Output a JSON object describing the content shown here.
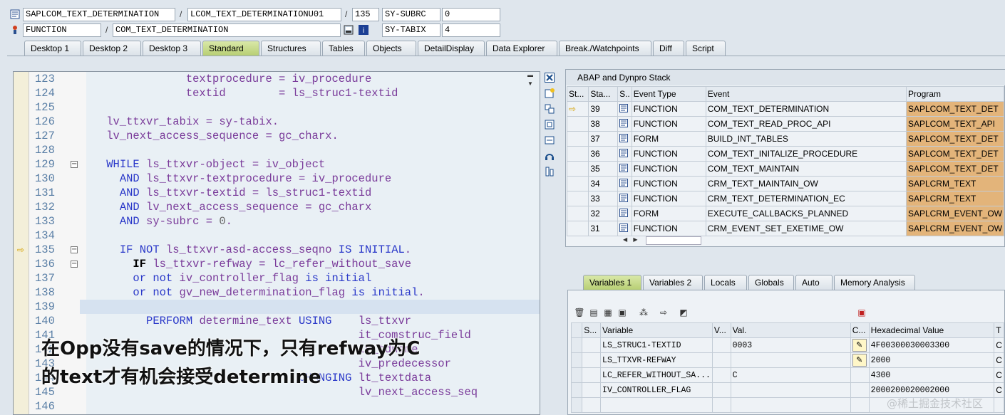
{
  "header": {
    "row1": {
      "program": "SAPLCOM_TEXT_DETERMINATION",
      "include": "LCOM_TEXT_DETERMINATIONU01",
      "line": "135",
      "var_name": "SY-SUBRC",
      "var_value": "0"
    },
    "row2": {
      "type": "FUNCTION",
      "name": "COM_TEXT_DETERMINATION",
      "var_name": "SY-TABIX",
      "var_value": "4"
    }
  },
  "tabs": [
    "Desktop 1",
    "Desktop 2",
    "Desktop 3",
    "Standard",
    "Structures",
    "Tables",
    "Objects",
    "DetailDisplay",
    "Data Explorer",
    "Break./Watchpoints",
    "Diff",
    "Script"
  ],
  "active_tab": "Standard",
  "code": {
    "lines": [
      {
        "n": "123",
        "t": "                textprocedure = iv_procedure"
      },
      {
        "n": "124",
        "t": "                textid        = ls_struc1-textid"
      },
      {
        "n": "125",
        "t": ""
      },
      {
        "n": "126",
        "t": "    lv_ttxvr_tabix = sy-tabix."
      },
      {
        "n": "127",
        "t": "    lv_next_access_sequence = gc_charx."
      },
      {
        "n": "128",
        "t": ""
      },
      {
        "n": "129",
        "t": "    WHILE ls_ttxvr-object = iv_object"
      },
      {
        "n": "130",
        "t": "      AND ls_ttxvr-textprocedure = iv_procedure"
      },
      {
        "n": "131",
        "t": "      AND ls_ttxvr-textid = ls_struc1-textid"
      },
      {
        "n": "132",
        "t": "      AND lv_next_access_sequence = gc_charx"
      },
      {
        "n": "133",
        "t": "      AND sy-subrc = 0."
      },
      {
        "n": "134",
        "t": ""
      },
      {
        "n": "135",
        "t": "      IF NOT ls_ttxvr-asd-access_seqno IS INITIAL."
      },
      {
        "n": "136",
        "t": "        IF ls_ttxvr-refway = lc_refer_without_save"
      },
      {
        "n": "137",
        "t": "        or not iv_controller_flag is initial"
      },
      {
        "n": "138",
        "t": "        or not gv_new_determination_flag is initial."
      },
      {
        "n": "139",
        "t": ""
      },
      {
        "n": "140",
        "t": "          PERFORM determine_text USING    ls_ttxvr"
      },
      {
        "n": "141",
        "t": "                                          it_comstruc_field"
      },
      {
        "n": "142",
        "t": "                                          iv_tdname"
      },
      {
        "n": "143",
        "t": "                                          iv_predecessor"
      },
      {
        "n": "144",
        "t": "                                 CHANGING lt_textdata"
      },
      {
        "n": "145",
        "t": "                                          lv_next_access_seq"
      },
      {
        "n": "146",
        "t": ""
      }
    ],
    "current_line": "135",
    "annotation_line1": "在Opp没有save的情况下，只有refway为C",
    "annotation_line2": "的text才有机会接受determine"
  },
  "stack": {
    "title": "ABAP and Dynpro Stack",
    "columns": [
      "St...",
      "Sta...",
      "S..",
      "Event Type",
      "Event",
      "Program"
    ],
    "rows": [
      {
        "level": "39",
        "type": "FUNCTION",
        "event": "COM_TEXT_DETERMINATION",
        "program": "SAPLCOM_TEXT_DET",
        "current": true
      },
      {
        "level": "38",
        "type": "FUNCTION",
        "event": "COM_TEXT_READ_PROC_API",
        "program": "SAPLCOM_TEXT_API",
        "current": false
      },
      {
        "level": "37",
        "type": "FORM",
        "event": "BUILD_INT_TABLES",
        "program": "SAPLCOM_TEXT_DET",
        "current": false
      },
      {
        "level": "36",
        "type": "FUNCTION",
        "event": "COM_TEXT_INITALIZE_PROCEDURE",
        "program": "SAPLCOM_TEXT_DET",
        "current": false
      },
      {
        "level": "35",
        "type": "FUNCTION",
        "event": "COM_TEXT_MAINTAIN",
        "program": "SAPLCOM_TEXT_DET",
        "current": false
      },
      {
        "level": "34",
        "type": "FUNCTION",
        "event": "CRM_TEXT_MAINTAIN_OW",
        "program": "SAPLCRM_TEXT",
        "current": false
      },
      {
        "level": "33",
        "type": "FUNCTION",
        "event": "CRM_TEXT_DETERMINATION_EC",
        "program": "SAPLCRM_TEXT",
        "current": false
      },
      {
        "level": "32",
        "type": "FORM",
        "event": "EXECUTE_CALLBACKS_PLANNED",
        "program": "SAPLCRM_EVENT_OW",
        "current": false
      },
      {
        "level": "31",
        "type": "FUNCTION",
        "event": "CRM_EVENT_SET_EXETIME_OW",
        "program": "SAPLCRM_EVENT_OW",
        "current": false
      }
    ]
  },
  "var_tabs": [
    "Variables 1",
    "Variables 2",
    "Locals",
    "Globals",
    "Auto",
    "Memory Analysis"
  ],
  "active_var_tab": "Variables 1",
  "variables": {
    "columns": [
      "S...",
      "Variable",
      "V...",
      "Val.",
      "C...",
      "Hexadecimal Value",
      "T"
    ],
    "rows": [
      {
        "name": "LS_STRUC1-TEXTID",
        "value": "0003",
        "hex": "4F00300030003300",
        "type": "C",
        "editable": true
      },
      {
        "name": "LS_TTXVR-REFWAY",
        "value": "",
        "hex": "2000",
        "type": "C",
        "editable": true
      },
      {
        "name": "LC_REFER_WITHOUT_SA...",
        "value": "C",
        "hex": "4300",
        "type": "C",
        "editable": false
      },
      {
        "name": "IV_CONTROLLER_FLAG",
        "value": "",
        "hex": "2000200020002000",
        "type": "C",
        "editable": false
      },
      {
        "name": "",
        "value": "",
        "hex": "",
        "type": "",
        "editable": false
      }
    ]
  },
  "watermark": "@稀土掘金技术社区",
  "colors": {
    "active_tab": "#b8cf74",
    "program_cell": "#e3b47a",
    "keyword": "#2a38c9",
    "identifier": "#7a3b9a"
  }
}
